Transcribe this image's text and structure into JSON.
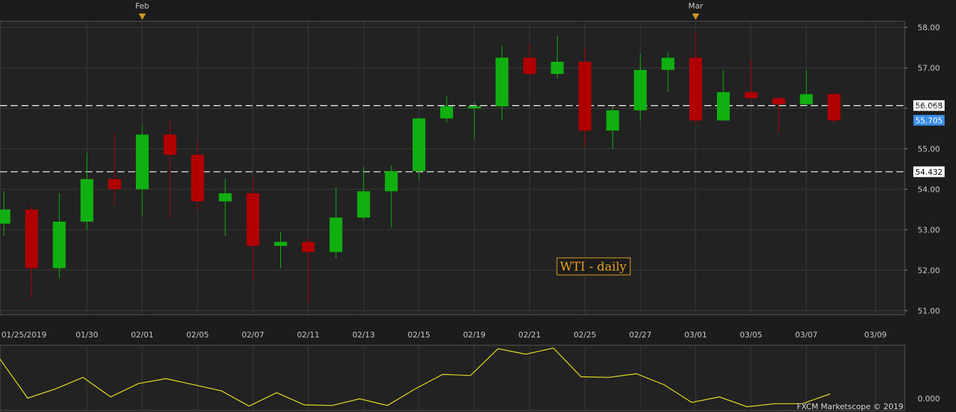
{
  "annotation": "WTI - daily",
  "copyright": "FXCM Marketscope © 2019",
  "colors": {
    "background": "#1c1c1c",
    "panel": "#222222",
    "grid": "#3a3a3a",
    "up": "#10b010",
    "down": "#b00000",
    "osc": "#e8e020",
    "annotation": "#e5a11c",
    "highlight": "#3a8ee6"
  },
  "chart_data": [
    {
      "type": "candlestick",
      "x_labels": [
        "01/25/2019",
        "01/30",
        "02/01",
        "02/05",
        "02/07",
        "02/11",
        "02/13",
        "02/15",
        "02/19",
        "02/21",
        "02/25",
        "02/27",
        "03/01",
        "03/05",
        "03/07",
        "03/09"
      ],
      "month_markers": [
        {
          "label": "Feb",
          "date": "02/01"
        },
        {
          "label": "Mar",
          "date": "03/01"
        }
      ],
      "ylim": [
        50.9,
        58.15
      ],
      "yticks": [
        "58.00",
        "57.00",
        "56.00",
        "55.00",
        "54.00",
        "53.00",
        "52.00",
        "51.00"
      ],
      "price_lines": [
        {
          "label": "56.068",
          "value": 56.068,
          "style": "dashed"
        },
        {
          "label": "54.432",
          "value": 54.432,
          "style": "dashed"
        }
      ],
      "current_price": {
        "label": "55.705",
        "value": 55.705
      },
      "candles": [
        {
          "date": "01/25",
          "open": 53.15,
          "high": 53.95,
          "low": 52.85,
          "close": 53.5
        },
        {
          "date": "01/28",
          "open": 53.5,
          "high": 53.6,
          "low": 51.3,
          "close": 52.05
        },
        {
          "date": "01/29",
          "open": 52.05,
          "high": 53.9,
          "low": 51.8,
          "close": 53.2
        },
        {
          "date": "01/30",
          "open": 53.2,
          "high": 54.9,
          "low": 53.0,
          "close": 54.25
        },
        {
          "date": "01/31",
          "open": 54.25,
          "high": 55.4,
          "low": 53.6,
          "close": 54.0
        },
        {
          "date": "02/01",
          "open": 54.0,
          "high": 55.6,
          "low": 53.35,
          "close": 55.35
        },
        {
          "date": "02/04",
          "open": 55.35,
          "high": 55.7,
          "low": 53.3,
          "close": 54.85
        },
        {
          "date": "02/05",
          "open": 54.85,
          "high": 55.2,
          "low": 53.5,
          "close": 53.7
        },
        {
          "date": "02/06",
          "open": 53.7,
          "high": 54.25,
          "low": 52.85,
          "close": 53.9
        },
        {
          "date": "02/07",
          "open": 53.9,
          "high": 54.3,
          "low": 51.75,
          "close": 52.6
        },
        {
          "date": "02/08",
          "open": 52.6,
          "high": 52.95,
          "low": 52.05,
          "close": 52.7
        },
        {
          "date": "02/11",
          "open": 52.7,
          "high": 52.8,
          "low": 51.2,
          "close": 52.45
        },
        {
          "date": "02/12",
          "open": 52.45,
          "high": 54.05,
          "low": 52.3,
          "close": 53.3
        },
        {
          "date": "02/13",
          "open": 53.3,
          "high": 54.55,
          "low": 53.25,
          "close": 53.95
        },
        {
          "date": "02/14",
          "open": 53.95,
          "high": 54.6,
          "low": 53.05,
          "close": 54.45
        },
        {
          "date": "02/15",
          "open": 54.45,
          "high": 55.75,
          "low": 54.25,
          "close": 55.75
        },
        {
          "date": "02/18",
          "open": 55.75,
          "high": 56.3,
          "low": 55.65,
          "close": 56.05
        },
        {
          "date": "02/19",
          "open": 56.0,
          "high": 56.15,
          "low": 55.25,
          "close": 56.05
        },
        {
          "date": "02/20",
          "open": 56.05,
          "high": 57.55,
          "low": 55.7,
          "close": 57.25
        },
        {
          "date": "02/21",
          "open": 57.25,
          "high": 57.6,
          "low": 56.8,
          "close": 56.85
        },
        {
          "date": "02/22",
          "open": 56.85,
          "high": 57.8,
          "low": 56.75,
          "close": 57.15
        },
        {
          "date": "02/25",
          "open": 57.15,
          "high": 57.5,
          "low": 55.05,
          "close": 55.45
        },
        {
          "date": "02/26",
          "open": 55.45,
          "high": 56.05,
          "low": 55.0,
          "close": 55.95
        },
        {
          "date": "02/27",
          "open": 55.95,
          "high": 57.35,
          "low": 55.7,
          "close": 56.95
        },
        {
          "date": "02/28",
          "open": 56.95,
          "high": 57.4,
          "low": 56.4,
          "close": 57.25
        },
        {
          "date": "03/01",
          "open": 57.25,
          "high": 57.9,
          "low": 55.6,
          "close": 55.7
        },
        {
          "date": "03/04",
          "open": 55.7,
          "high": 56.95,
          "low": 55.7,
          "close": 56.4
        },
        {
          "date": "03/05",
          "open": 56.4,
          "high": 57.2,
          "low": 56.2,
          "close": 56.25
        },
        {
          "date": "03/06",
          "open": 56.25,
          "high": 56.3,
          "low": 55.4,
          "close": 56.1
        },
        {
          "date": "03/07",
          "open": 56.1,
          "high": 56.95,
          "low": 56.05,
          "close": 56.35
        },
        {
          "date": "03/08",
          "open": 56.35,
          "high": 56.4,
          "low": 55.6,
          "close": 55.7
        }
      ]
    },
    {
      "type": "line",
      "series_label": "0.000",
      "ylim": [
        0,
        1
      ],
      "values": [
        0.82,
        0.18,
        0.33,
        0.52,
        0.2,
        0.42,
        0.5,
        0.4,
        0.3,
        0.05,
        0.27,
        0.07,
        0.06,
        0.17,
        0.06,
        0.33,
        0.57,
        0.55,
        0.99,
        0.9,
        1.0,
        0.53,
        0.52,
        0.58,
        0.4,
        0.11,
        0.2,
        0.04,
        0.09,
        0.09,
        0.25
      ]
    }
  ]
}
